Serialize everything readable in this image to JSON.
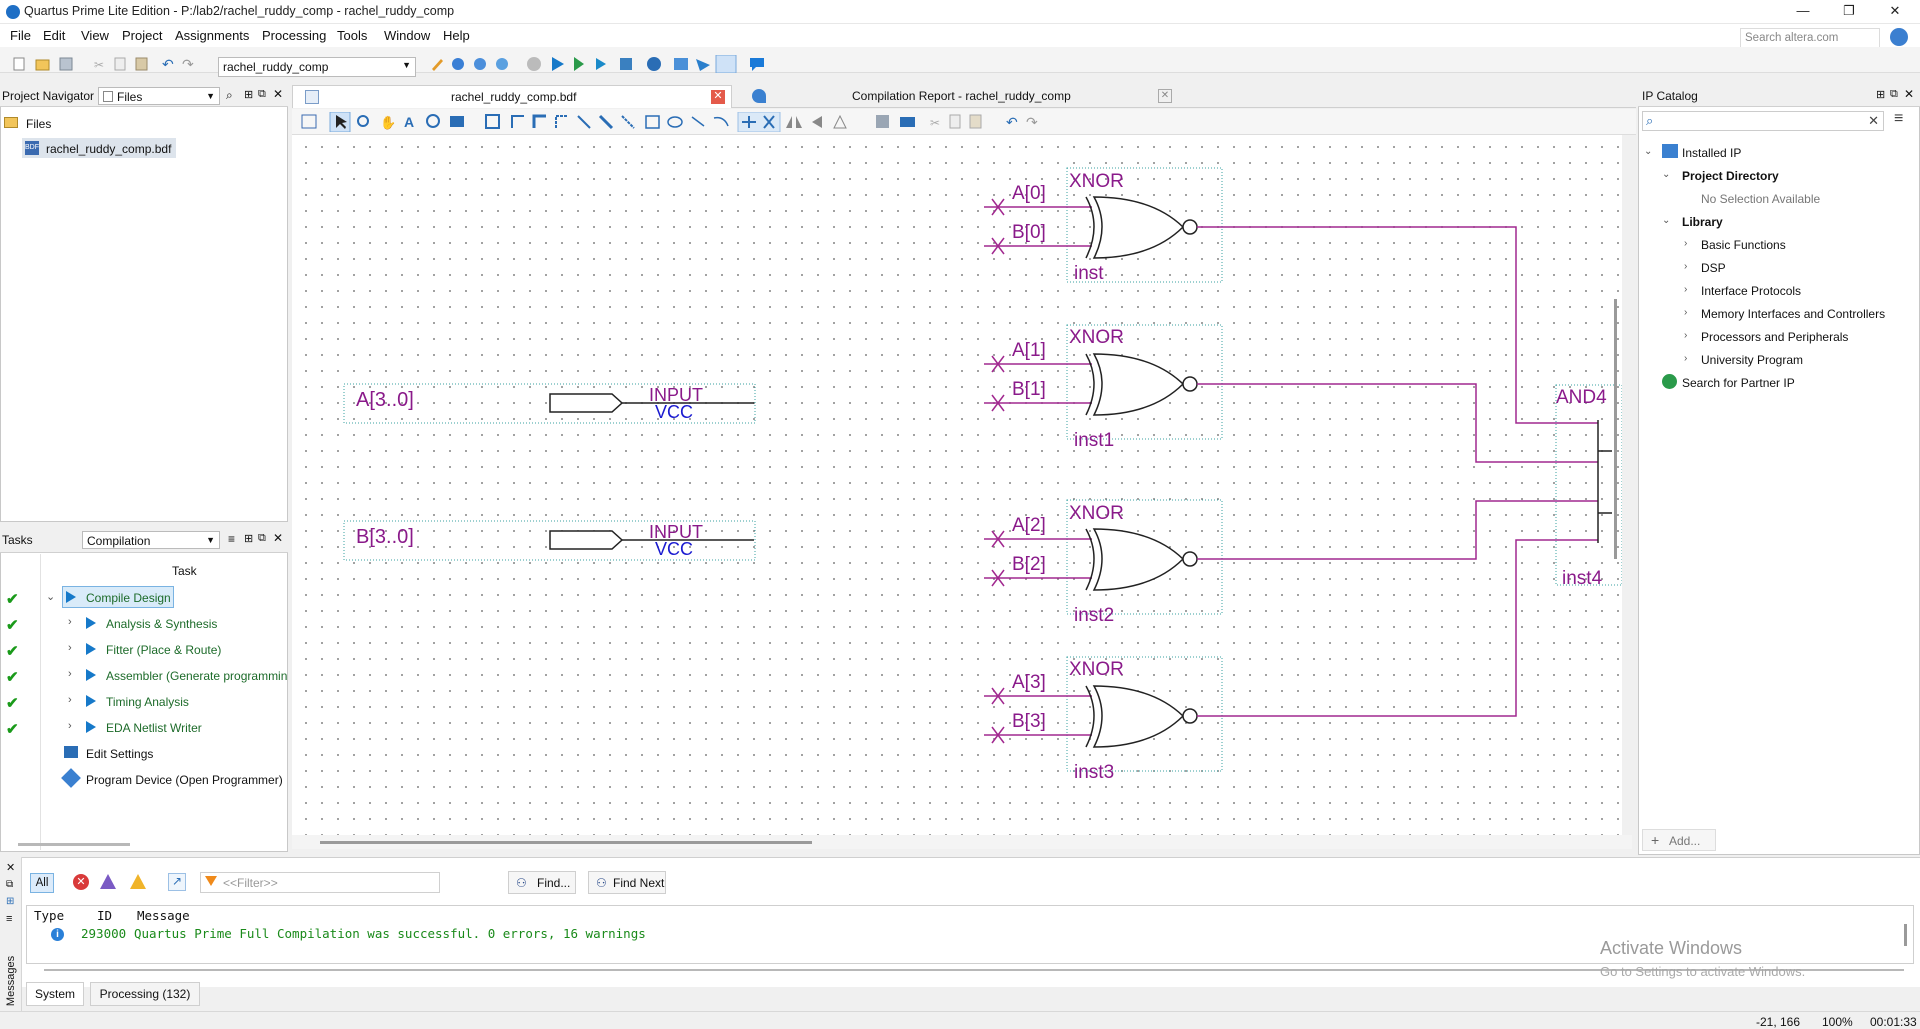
{
  "window": {
    "title": "Quartus Prime Lite Edition - P:/lab2/rachel_ruddy_comp - rachel_ruddy_comp",
    "minimize": "—",
    "maximize": "❐",
    "close": "✕"
  },
  "menu": [
    "File",
    "Edit",
    "View",
    "Project",
    "Assignments",
    "Processing",
    "Tools",
    "Window",
    "Help"
  ],
  "search": {
    "placeholder": "Search altera.com"
  },
  "toolbar": {
    "revision": "rachel_ruddy_comp"
  },
  "project_navigator": {
    "title": "Project Navigator",
    "view": "Files",
    "folder": "Files",
    "file": "rachel_ruddy_comp.bdf"
  },
  "tasks": {
    "title": "Tasks",
    "flow": "Compilation",
    "column": "Task",
    "items": [
      {
        "label": "Compile Design",
        "done": "✔",
        "expand": "⌄"
      },
      {
        "label": "Analysis & Synthesis",
        "done": "✔",
        "expand": "›"
      },
      {
        "label": "Fitter (Place & Route)",
        "done": "✔",
        "expand": "›"
      },
      {
        "label": "Assembler (Generate programmin",
        "done": "✔",
        "expand": "›"
      },
      {
        "label": "Timing Analysis",
        "done": "✔",
        "expand": "›"
      },
      {
        "label": "EDA Netlist Writer",
        "done": "✔",
        "expand": "›"
      },
      {
        "label": "Edit Settings"
      },
      {
        "label": "Program Device (Open Programmer)"
      }
    ]
  },
  "tabs": [
    {
      "label": "rachel_ruddy_comp.bdf"
    },
    {
      "label": "Compilation Report - rachel_ruddy_comp"
    }
  ],
  "schematic": {
    "inputs": [
      {
        "name": "A[3..0]",
        "type": "INPUT",
        "default": "VCC"
      },
      {
        "name": "B[3..0]",
        "type": "INPUT",
        "default": "VCC"
      }
    ],
    "gates": [
      {
        "kind": "XNOR",
        "inst": "inst",
        "a": "A[0]",
        "b": "B[0]"
      },
      {
        "kind": "XNOR",
        "inst": "inst1",
        "a": "A[1]",
        "b": "B[1]"
      },
      {
        "kind": "XNOR",
        "inst": "inst2",
        "a": "A[2]",
        "b": "B[2]"
      },
      {
        "kind": "XNOR",
        "inst": "inst3",
        "a": "A[3]",
        "b": "B[3]"
      }
    ],
    "and_gate": {
      "kind": "AND4",
      "inst": "inst4"
    }
  },
  "ip_catalog": {
    "title": "IP Catalog",
    "installed": "Installed IP",
    "project_dir": "Project Directory",
    "no_selection": "No Selection Available",
    "library": "Library",
    "library_items": [
      "Basic Functions",
      "DSP",
      "Interface Protocols",
      "Memory Interfaces and Controllers",
      "Processors and Peripherals",
      "University Program"
    ],
    "partner": "Search for Partner IP",
    "add": "Add..."
  },
  "messages": {
    "filter_all": "All",
    "filter_placeholder": "<<Filter>>",
    "find": "Find...",
    "find_next": "Find Next",
    "col_type": "Type",
    "col_id": "ID",
    "col_message": "Message",
    "rows": [
      {
        "id": "293000",
        "text": "Quartus Prime Full Compilation was successful. 0 errors, 16 warnings"
      }
    ],
    "side_label": "Messages",
    "tab_system": "System",
    "tab_processing": "Processing (132)"
  },
  "watermark": {
    "line1": "Activate Windows",
    "line2": "Go to Settings to activate Windows."
  },
  "status": {
    "coords": "-21, 166",
    "zoom": "100%",
    "elapsed": "00:01:33"
  },
  "colors": {
    "wire": "#a1288f",
    "label": "#8a1a8a",
    "vcc": "#1a1ad0",
    "accent": "#1679c9"
  }
}
